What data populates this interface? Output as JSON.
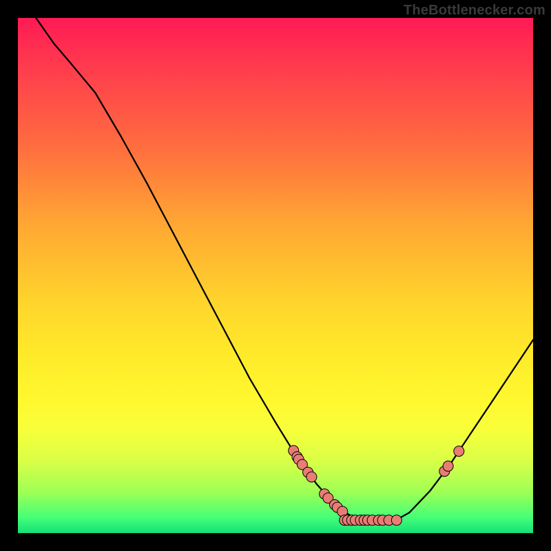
{
  "watermark": "TheBottlenecker.com",
  "chart_data": {
    "type": "line",
    "title": "",
    "xlabel": "",
    "ylabel": "",
    "xlim": [
      0,
      100
    ],
    "ylim": [
      0,
      100
    ],
    "curve": [
      {
        "x": 3.5,
        "y": 100.0
      },
      {
        "x": 7.0,
        "y": 95.0
      },
      {
        "x": 10.0,
        "y": 91.5
      },
      {
        "x": 15.0,
        "y": 85.5
      },
      {
        "x": 20.0,
        "y": 77.0
      },
      {
        "x": 25.0,
        "y": 68.0
      },
      {
        "x": 30.0,
        "y": 58.5
      },
      {
        "x": 35.0,
        "y": 49.0
      },
      {
        "x": 40.0,
        "y": 39.5
      },
      {
        "x": 45.0,
        "y": 30.0
      },
      {
        "x": 50.0,
        "y": 21.5
      },
      {
        "x": 54.0,
        "y": 15.0
      },
      {
        "x": 58.0,
        "y": 9.5
      },
      {
        "x": 62.0,
        "y": 5.0
      },
      {
        "x": 66.0,
        "y": 2.5
      },
      {
        "x": 70.0,
        "y": 1.7
      },
      {
        "x": 73.0,
        "y": 2.3
      },
      {
        "x": 76.0,
        "y": 4.0
      },
      {
        "x": 80.0,
        "y": 8.2
      },
      {
        "x": 84.0,
        "y": 13.5
      },
      {
        "x": 88.0,
        "y": 19.5
      },
      {
        "x": 92.0,
        "y": 25.5
      },
      {
        "x": 96.0,
        "y": 31.5
      },
      {
        "x": 100.0,
        "y": 37.5
      }
    ],
    "marker_clusters": [
      {
        "x": 53.5,
        "y": 16.0
      },
      {
        "x": 54.2,
        "y": 14.8
      },
      {
        "x": 54.5,
        "y": 14.3
      },
      {
        "x": 55.2,
        "y": 13.3
      },
      {
        "x": 56.3,
        "y": 11.8
      },
      {
        "x": 57.0,
        "y": 10.9
      },
      {
        "x": 59.5,
        "y": 7.6
      },
      {
        "x": 60.2,
        "y": 6.8
      },
      {
        "x": 61.5,
        "y": 5.5
      },
      {
        "x": 62.0,
        "y": 5.0
      },
      {
        "x": 63.0,
        "y": 4.2
      },
      {
        "x": 63.4,
        "y": 2.5
      },
      {
        "x": 64.0,
        "y": 2.5
      },
      {
        "x": 64.8,
        "y": 2.5
      },
      {
        "x": 65.5,
        "y": 2.5
      },
      {
        "x": 66.5,
        "y": 2.5
      },
      {
        "x": 67.2,
        "y": 2.5
      },
      {
        "x": 67.9,
        "y": 2.5
      },
      {
        "x": 68.8,
        "y": 2.5
      },
      {
        "x": 70.0,
        "y": 2.5
      },
      {
        "x": 70.8,
        "y": 2.5
      },
      {
        "x": 72.0,
        "y": 2.5
      },
      {
        "x": 73.5,
        "y": 2.5
      },
      {
        "x": 82.8,
        "y": 12.0
      },
      {
        "x": 83.5,
        "y": 13.0
      },
      {
        "x": 85.6,
        "y": 15.9
      }
    ],
    "marker_style": {
      "fill": "#e97c74",
      "stroke": "#000",
      "r": 7.5
    },
    "curve_style": {
      "stroke": "#000",
      "width": 2.3
    }
  }
}
